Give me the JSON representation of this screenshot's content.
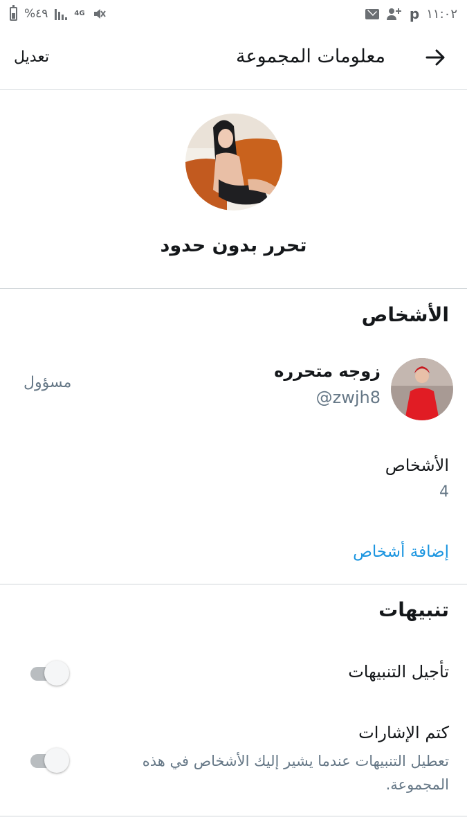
{
  "status_bar": {
    "battery_text": "%٤٩",
    "network_label": "4G",
    "time": "١١:٠٢",
    "icons": [
      "battery-icon",
      "signal-icon",
      "network-4g-icon",
      "mute-icon",
      "mail-icon",
      "person-add-icon",
      "p-icon"
    ]
  },
  "header": {
    "title": "معلومات المجموعة",
    "edit_label": "تعديل",
    "back_icon": "arrow-right-icon"
  },
  "group": {
    "name": "تحرر بدون حدود"
  },
  "members": {
    "section_title": "الأشخاص",
    "list": [
      {
        "name": "زوجه متحرره",
        "handle": "@zwjh8",
        "role": "مسؤول"
      }
    ],
    "count_label": "الأشخاص",
    "count_value": "4",
    "add_label": "إضافة أشخاص"
  },
  "notifications": {
    "section_title": "تنبيهات",
    "snooze": {
      "label": "تأجيل التنبيهات",
      "enabled": false
    },
    "mute_mentions": {
      "label": "كتم الإشارات",
      "description": "تعطيل التنبيهات عندما يشير إليك الأشخاص في هذه المجموعة.",
      "enabled": false
    }
  },
  "colors": {
    "link": "#1b95e0",
    "secondary_text": "#657786",
    "divider": "#cfd4d8",
    "toggle_off_track": "#b9bdc0"
  }
}
